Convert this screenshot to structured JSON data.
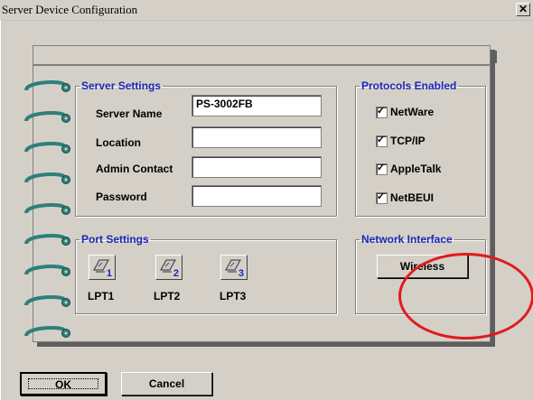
{
  "window": {
    "title": "Server Device Configuration",
    "close_glyph": "✕"
  },
  "server_settings": {
    "legend": "Server Settings",
    "server_name_label": "Server Name",
    "server_name_value": "PS-3002FB",
    "location_label": "Location",
    "location_value": "",
    "admin_contact_label": "Admin Contact",
    "admin_contact_value": "",
    "password_label": "Password",
    "password_value": ""
  },
  "protocols": {
    "legend": "Protocols Enabled",
    "items": [
      {
        "label": "NetWare",
        "checked": true
      },
      {
        "label": "TCP/IP",
        "checked": true
      },
      {
        "label": "AppleTalk",
        "checked": true
      },
      {
        "label": "NetBEUI",
        "checked": true
      }
    ]
  },
  "port_settings": {
    "legend": "Port Settings",
    "ports": [
      {
        "label": "LPT1",
        "number": "1"
      },
      {
        "label": "LPT2",
        "number": "2"
      },
      {
        "label": "LPT3",
        "number": "3"
      }
    ]
  },
  "network_interface": {
    "legend": "Network Interface",
    "button_label": "Wireless"
  },
  "footer": {
    "ok_label": "OK",
    "cancel_label": "Cancel"
  },
  "colors": {
    "legend_blue": "#1a28b8",
    "ring_teal": "#2e7f7a",
    "highlight_red": "#e21a1a"
  }
}
